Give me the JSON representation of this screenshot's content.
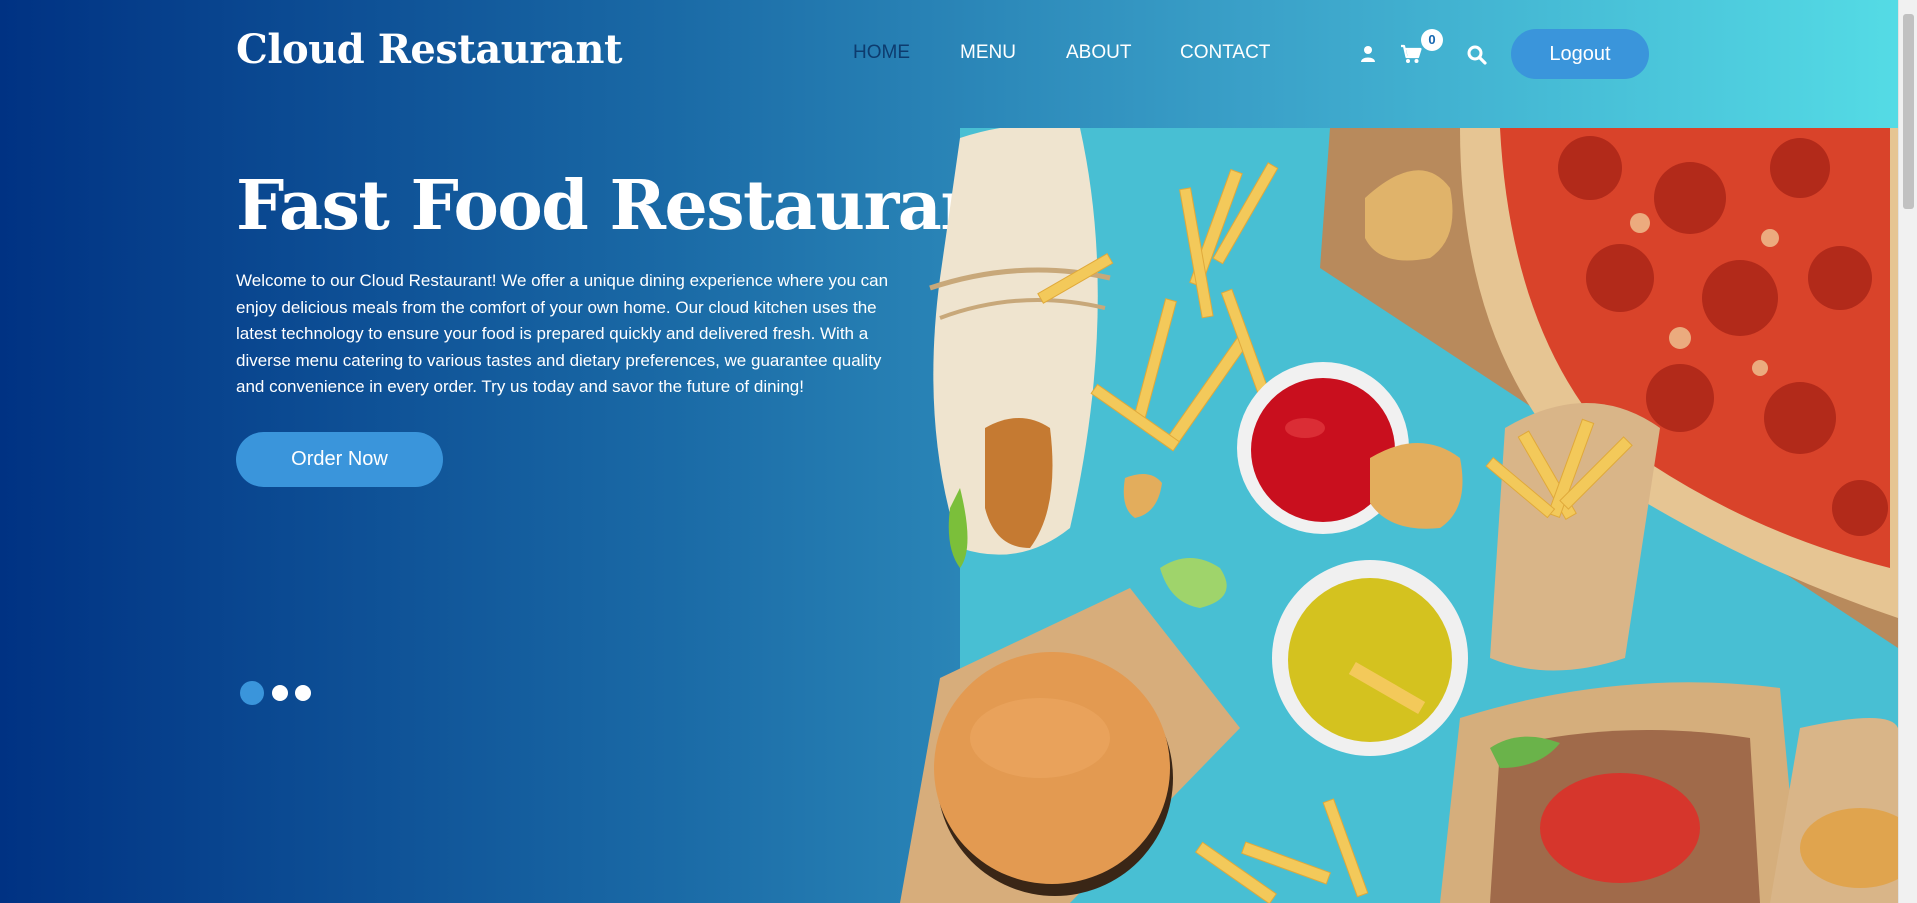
{
  "header": {
    "brand": "Cloud Restaurant",
    "nav": [
      {
        "label": "HOME",
        "active": true
      },
      {
        "label": "MENU",
        "active": false
      },
      {
        "label": "ABOUT",
        "active": false
      },
      {
        "label": "CONTACT",
        "active": false
      }
    ],
    "icons": [
      "user-icon",
      "cart-icon",
      "search-icon"
    ],
    "cart_count": "0",
    "logout_label": "Logout"
  },
  "hero": {
    "title": "Fast Food Restaurant",
    "text": "Welcome to our Cloud Restaurant! We offer a unique dining experience where you can enjoy delicious meals from the comfort of your own home. Our cloud kitchen uses the latest technology to ensure your food is prepared quickly and delivered fresh. With a diverse menu catering to various tastes and dietary preferences, we guarantee quality and convenience in every order. Try us today and savor the future of dining!",
    "cta_label": "Order Now",
    "slides": 3,
    "active_slide": 1
  },
  "colors": {
    "gradient_start": "#003283",
    "gradient_end": "#55dde6",
    "accent": "#3a95db",
    "active_nav": "#0d3b6e"
  }
}
